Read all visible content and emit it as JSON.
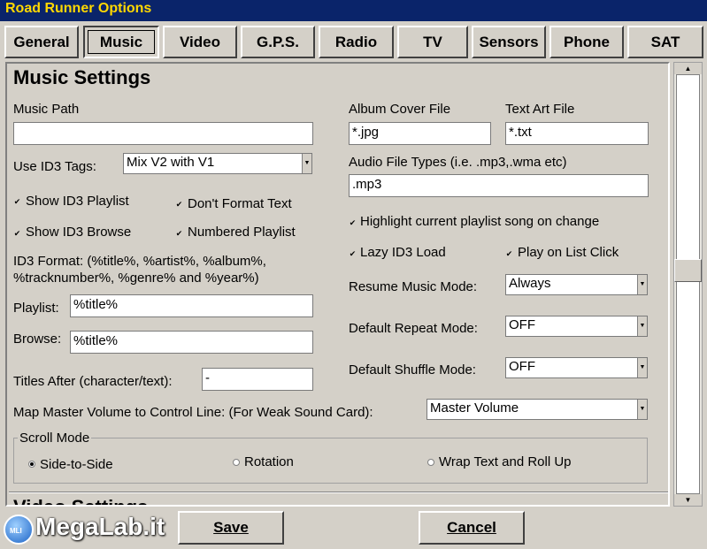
{
  "window": {
    "title": "Road Runner Options"
  },
  "tabs": [
    "General",
    "Music",
    "Video",
    "G.P.S.",
    "Radio",
    "TV",
    "Sensors",
    "Phone",
    "SAT"
  ],
  "music": {
    "section_title": "Music Settings",
    "music_path_label": "Music Path",
    "music_path_value": "",
    "use_id3_label": "Use ID3 Tags:",
    "use_id3_value": "Mix V2 with V1",
    "show_id3_playlist": {
      "label": "Show ID3 Playlist",
      "checked": true
    },
    "dont_format_text": {
      "label": "Don't Format Text",
      "checked": true
    },
    "show_id3_browse": {
      "label": "Show ID3 Browse",
      "checked": true
    },
    "numbered_playlist": {
      "label": "Numbered Playlist",
      "checked": true
    },
    "id3_format_line1": "ID3 Format: (%title%, %artist%, %album%,",
    "id3_format_line2": "%tracknumber%, %genre% and %year%)",
    "playlist_label": "Playlist:",
    "playlist_value": "%title%",
    "browse_label": "Browse:",
    "browse_value": "%title%",
    "titles_after_label": "Titles After (character/text):",
    "titles_after_value": "-",
    "album_cover_label": "Album Cover File",
    "album_cover_value": "*.jpg",
    "text_art_label": "Text Art File",
    "text_art_value": "*.txt",
    "audio_types_label": "Audio File Types (i.e. .mp3,.wma etc)",
    "audio_types_value": ".mp3",
    "highlight_current": {
      "label": "Highlight current playlist song on change",
      "checked": true
    },
    "lazy_id3": {
      "label": "Lazy ID3 Load",
      "checked": true
    },
    "play_on_click": {
      "label": "Play on List Click",
      "checked": true
    },
    "resume_label": "Resume Music Mode:",
    "resume_value": "Always",
    "repeat_label": "Default Repeat Mode:",
    "repeat_value": "OFF",
    "shuffle_label": "Default Shuffle Mode:",
    "shuffle_value": "OFF",
    "map_master_label": "Map Master Volume to Control Line: (For Weak Sound Card):",
    "map_master_value": "Master Volume",
    "scroll_mode_label": "Scroll Mode",
    "scroll_options": [
      "Side-to-Side",
      "Rotation",
      "Wrap Text and Roll Up"
    ],
    "scroll_selected": "Side-to-Side"
  },
  "video": {
    "section_title": "Video Settings"
  },
  "buttons": {
    "save": "Save",
    "cancel": "Cancel"
  },
  "watermark": {
    "text": "MegaLab.it",
    "badge": "MLI"
  }
}
